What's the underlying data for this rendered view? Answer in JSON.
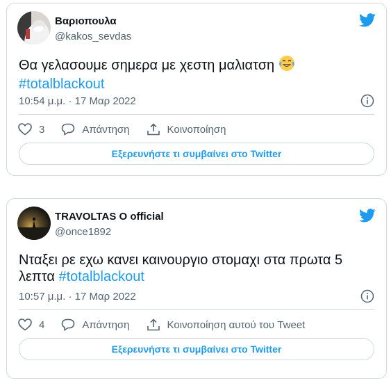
{
  "tweets": [
    {
      "display_name": "Βαριοπουλα",
      "handle": "@kakos_sevdas",
      "text": "Θα γελασουμε σημερα με χεστη μαλιατση",
      "emoji_icon": "face-with-tears-of-joy",
      "hashtag": "#totalblackout",
      "timestamp": "10:54 μ.μ. · 17 Μαρ 2022",
      "likes": "3",
      "reply_label": "Απάντηση",
      "share_label": "Κοινοποίηση",
      "explore_label": "Εξερευνήστε τι συμβαίνει στο Twitter"
    },
    {
      "display_name": "TRAVOLTAS O official",
      "handle": "@once1892",
      "text": "Νταξει ρε εχω κανει καινουργιο στομαχι στα πρωτα 5 λεπτα",
      "hashtag": "#totalblackout",
      "timestamp": "10:57 μ.μ. · 17 Μαρ 2022",
      "likes": "4",
      "reply_label": "Απάντηση",
      "share_label": "Κοινοποίηση αυτού του Tweet",
      "explore_label": "Εξερευνήστε τι συμβαίνει στο Twitter"
    }
  ],
  "colors": {
    "accent": "#1d9bf0",
    "text": "#0f1419",
    "muted": "#536471",
    "border": "#cfd9de"
  }
}
